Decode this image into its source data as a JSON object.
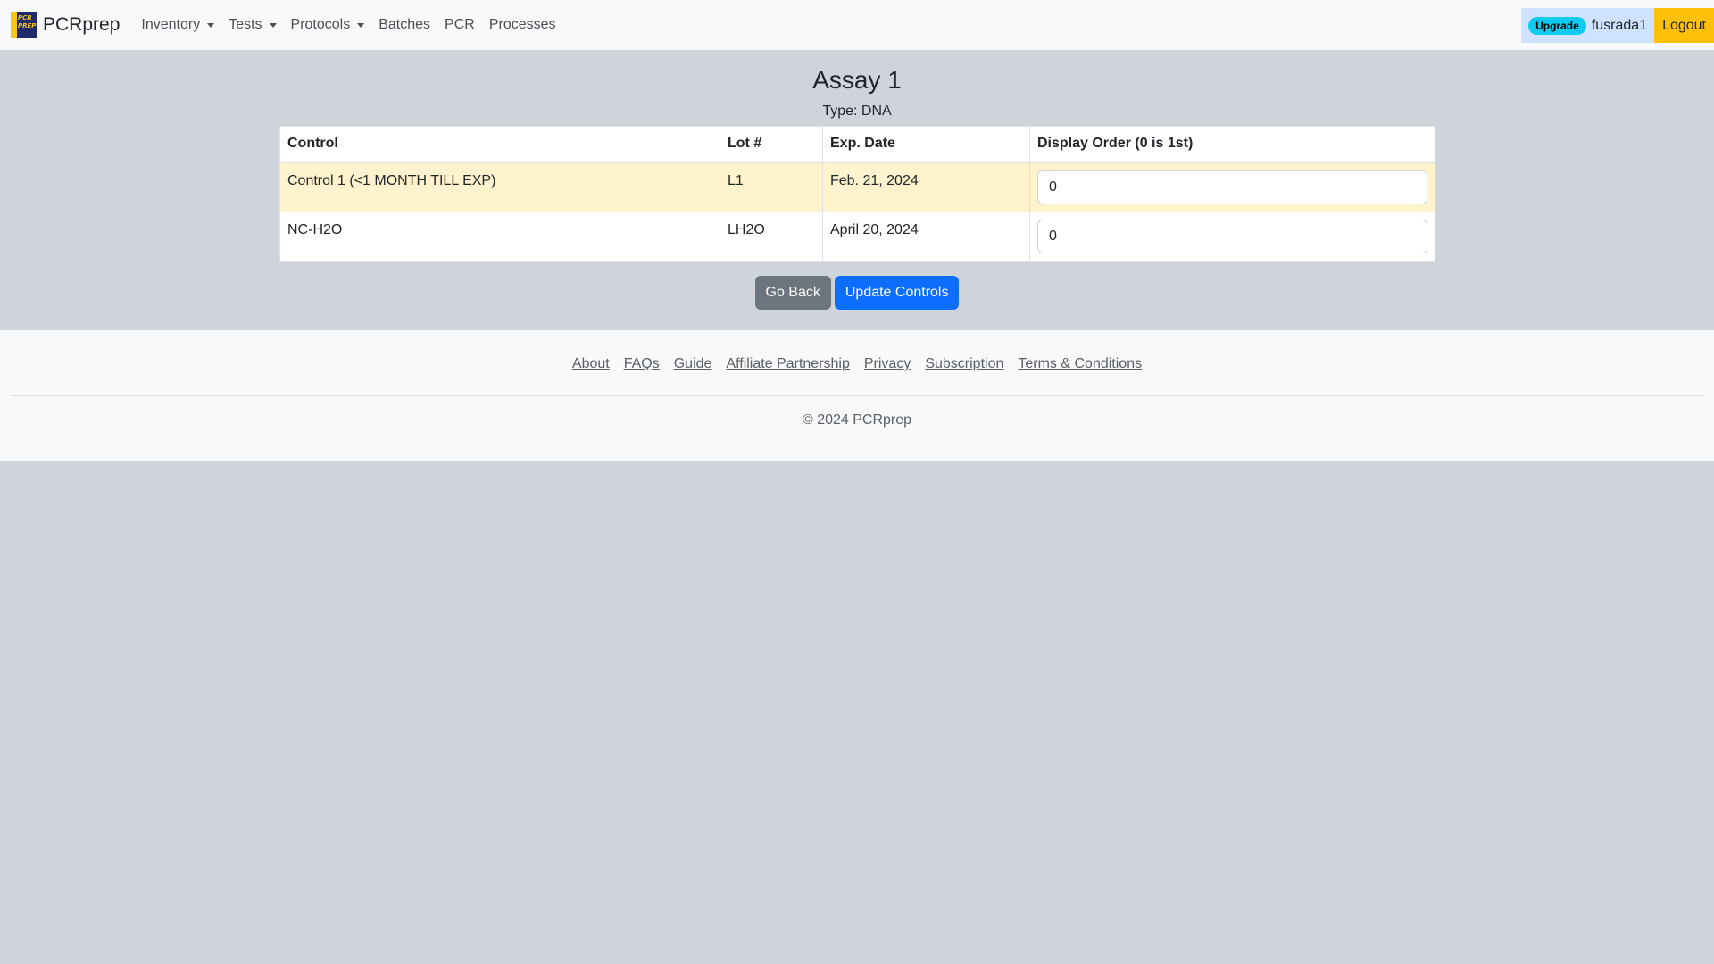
{
  "navbar": {
    "brand": "PCRprep",
    "logo_text": "PCR PREP",
    "items": [
      {
        "label": "Inventory",
        "dropdown": true
      },
      {
        "label": "Tests",
        "dropdown": true
      },
      {
        "label": "Protocols",
        "dropdown": true
      },
      {
        "label": "Batches",
        "dropdown": false
      },
      {
        "label": "PCR",
        "dropdown": false
      },
      {
        "label": "Processes",
        "dropdown": false
      }
    ],
    "upgrade_badge": "Upgrade",
    "username": "fusrada1",
    "logout": "Logout"
  },
  "main": {
    "title": "Assay 1",
    "subtitle": "Type: DNA",
    "table": {
      "headers": [
        "Control",
        "Lot #",
        "Exp. Date",
        "Display Order (0 is 1st)"
      ],
      "rows": [
        {
          "control": "Control 1 (<1 MONTH TILL EXP)",
          "lot": "L1",
          "exp_date": "Feb. 21, 2024",
          "display_order": "0",
          "status": "warning"
        },
        {
          "control": "NC-H2O",
          "lot": "LH2O",
          "exp_date": "April 20, 2024",
          "display_order": "0",
          "status": "normal"
        }
      ]
    },
    "buttons": {
      "go_back": "Go Back",
      "update": "Update Controls"
    }
  },
  "footer": {
    "links": [
      "About",
      "FAQs",
      "Guide",
      "Affiliate Partnership",
      "Privacy",
      "Subscription",
      "Terms & Conditions"
    ],
    "copyright": "© 2024 PCRprep"
  },
  "colors": {
    "page_bg": "#cfd4db",
    "navbar_bg": "#f8f9fa",
    "warning_row": "#fff3cd",
    "primary": "#0d6efd",
    "secondary": "#6c757d",
    "upgrade_badge": "#0dcaf0",
    "logout": "#ffc107"
  }
}
